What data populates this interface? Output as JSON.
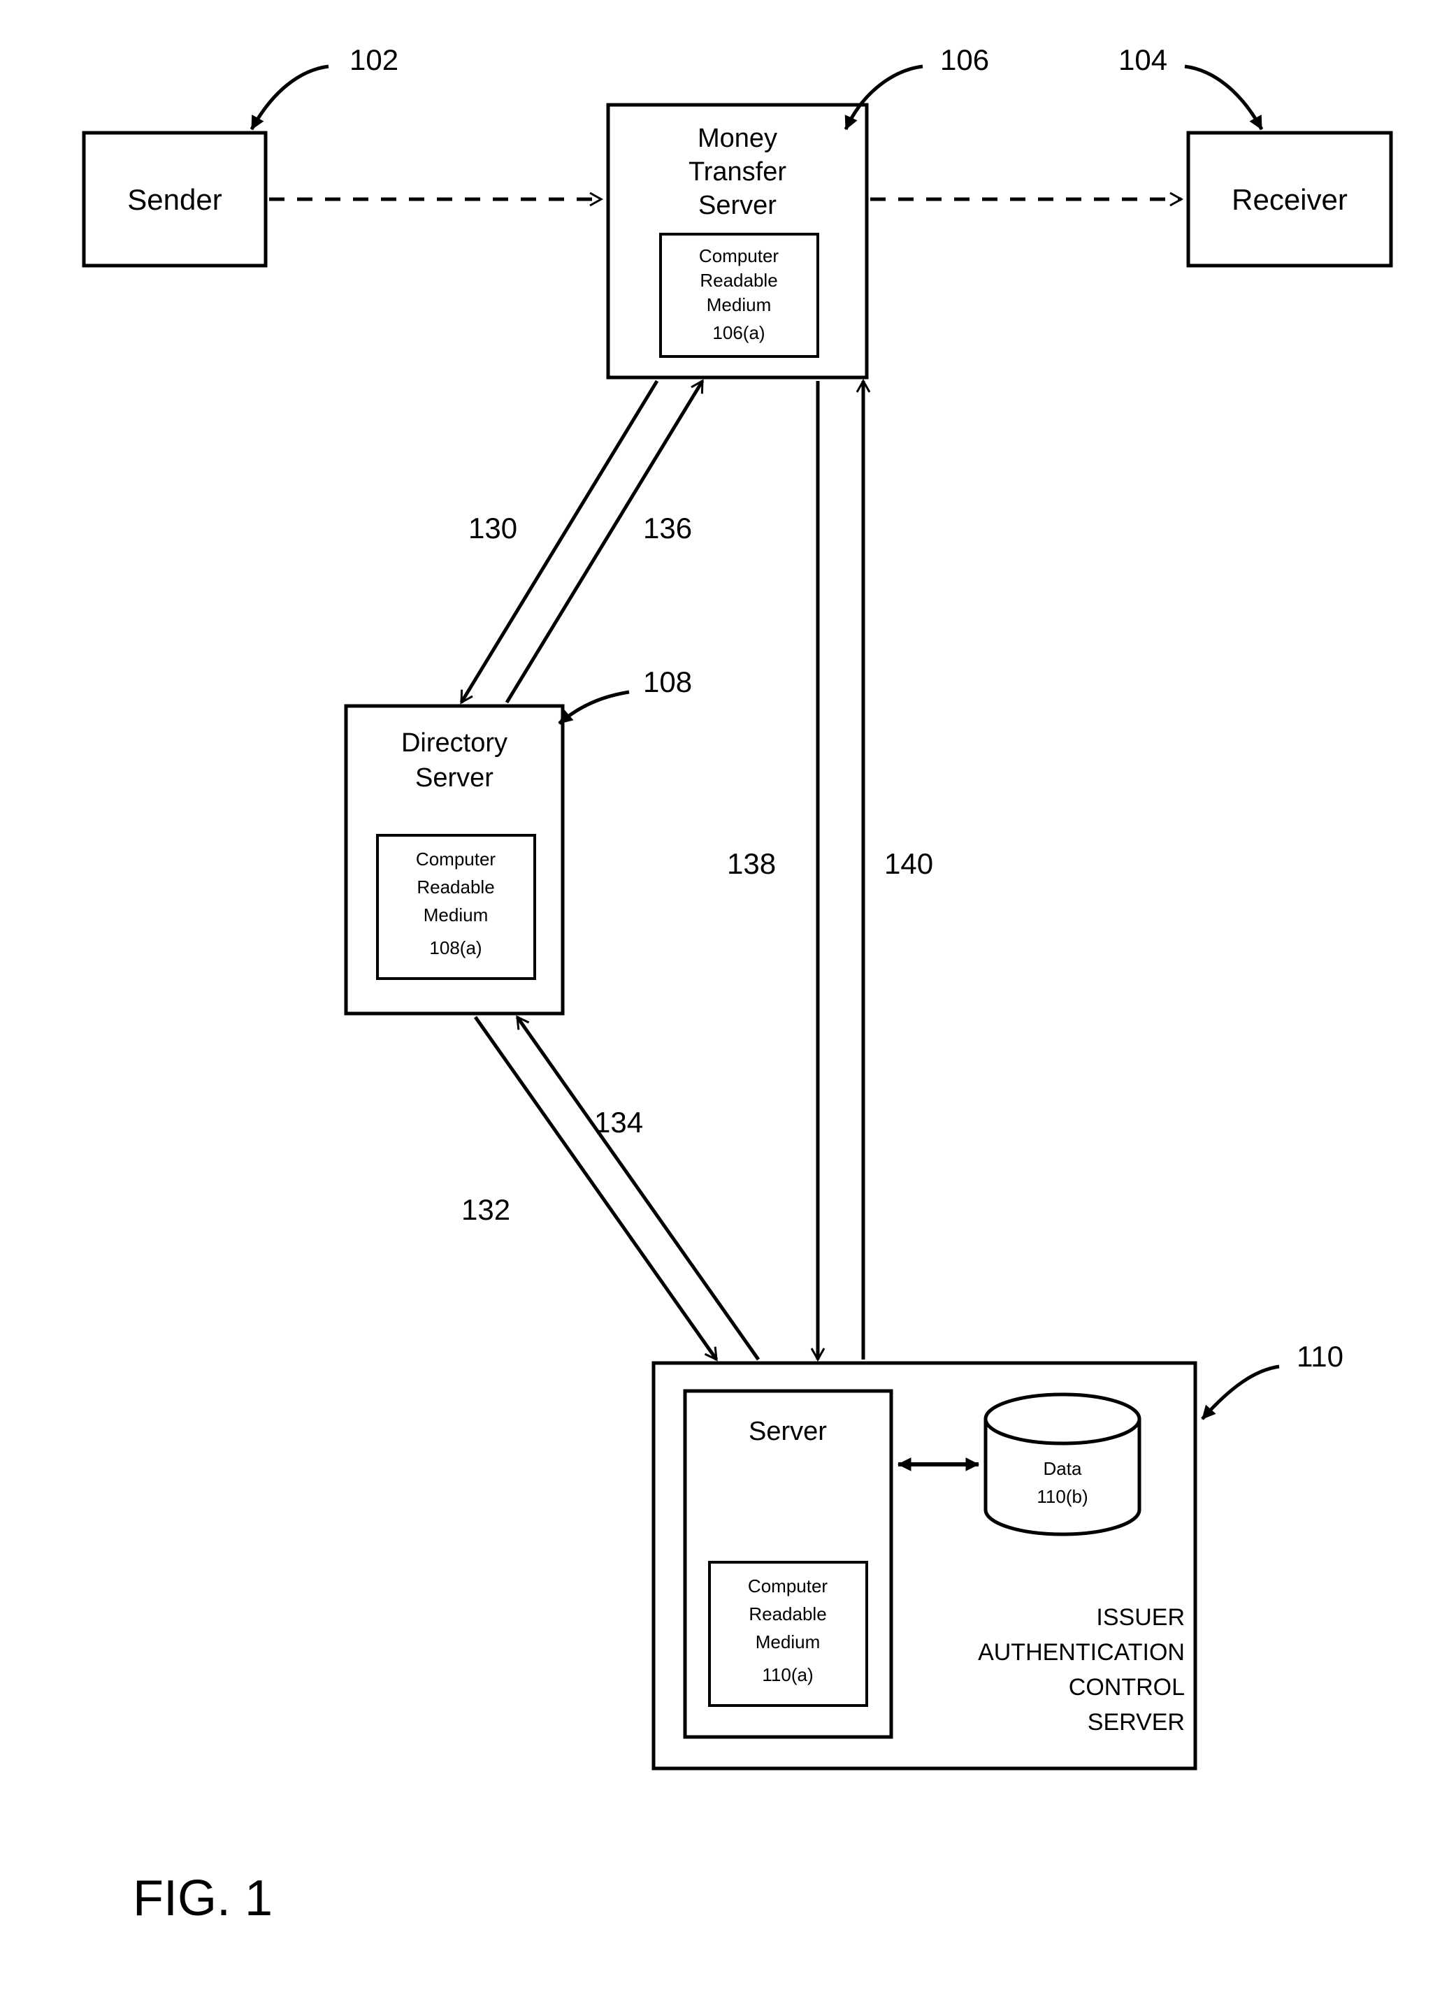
{
  "figure_label": "FIG. 1",
  "sender": {
    "label": "Sender",
    "ref": "102"
  },
  "receiver": {
    "label": "Receiver",
    "ref": "104"
  },
  "money_server": {
    "label1": "Money",
    "label2": "Transfer",
    "label3": "Server",
    "ref": "106"
  },
  "money_server_crm": {
    "l1": "Computer",
    "l2": "Readable",
    "l3": "Medium",
    "l4": "106(a)"
  },
  "directory_server": {
    "label1": "Directory",
    "label2": "Server",
    "ref": "108"
  },
  "directory_server_crm": {
    "l1": "Computer",
    "l2": "Readable",
    "l3": "Medium",
    "l4": "108(a)"
  },
  "issuer": {
    "label1": "ISSUER",
    "label2": "AUTHENTICATION",
    "label3": "CONTROL",
    "label4": "SERVER",
    "ref": "110"
  },
  "issuer_server": {
    "label": "Server"
  },
  "issuer_server_crm": {
    "l1": "Computer",
    "l2": "Readable",
    "l3": "Medium",
    "l4": "110(a)"
  },
  "issuer_data": {
    "label1": "Data",
    "label2": "110(b)"
  },
  "arrows": {
    "mts_ds_down": "130",
    "ds_mts_up": "136",
    "ds_acs_down": "132",
    "acs_ds_up": "134",
    "mts_acs_down": "138",
    "acs_mts_up": "140"
  }
}
